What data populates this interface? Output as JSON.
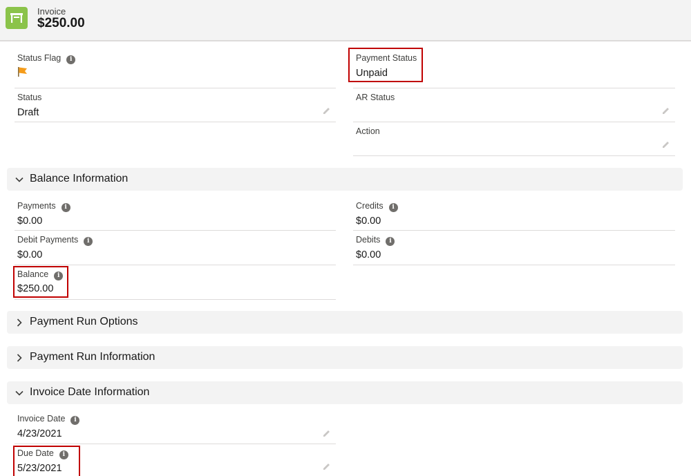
{
  "header": {
    "object_label": "Invoice",
    "title": "$250.00"
  },
  "fields": {
    "status_flag": {
      "label": "Status Flag"
    },
    "payment_status": {
      "label": "Payment Status",
      "value": "Unpaid"
    },
    "status": {
      "label": "Status",
      "value": "Draft"
    },
    "ar_status": {
      "label": "AR Status",
      "value": ""
    },
    "action": {
      "label": "Action",
      "value": ""
    }
  },
  "sections": {
    "balance_information": {
      "title": "Balance Information",
      "payments": {
        "label": "Payments",
        "value": "$0.00"
      },
      "credits": {
        "label": "Credits",
        "value": "$0.00"
      },
      "debit_payments": {
        "label": "Debit Payments",
        "value": "$0.00"
      },
      "debits": {
        "label": "Debits",
        "value": "$0.00"
      },
      "balance": {
        "label": "Balance",
        "value": "$250.00"
      }
    },
    "payment_run_options": {
      "title": "Payment Run Options"
    },
    "payment_run_information": {
      "title": "Payment Run Information"
    },
    "invoice_date_information": {
      "title": "Invoice Date Information",
      "invoice_date": {
        "label": "Invoice Date",
        "value": "4/23/2021"
      },
      "due_date": {
        "label": "Due Date",
        "value": "5/23/2021"
      }
    }
  },
  "colors": {
    "header_icon": "#8bc34a",
    "highlight": "#c00000",
    "flag": "#f59c1a"
  }
}
